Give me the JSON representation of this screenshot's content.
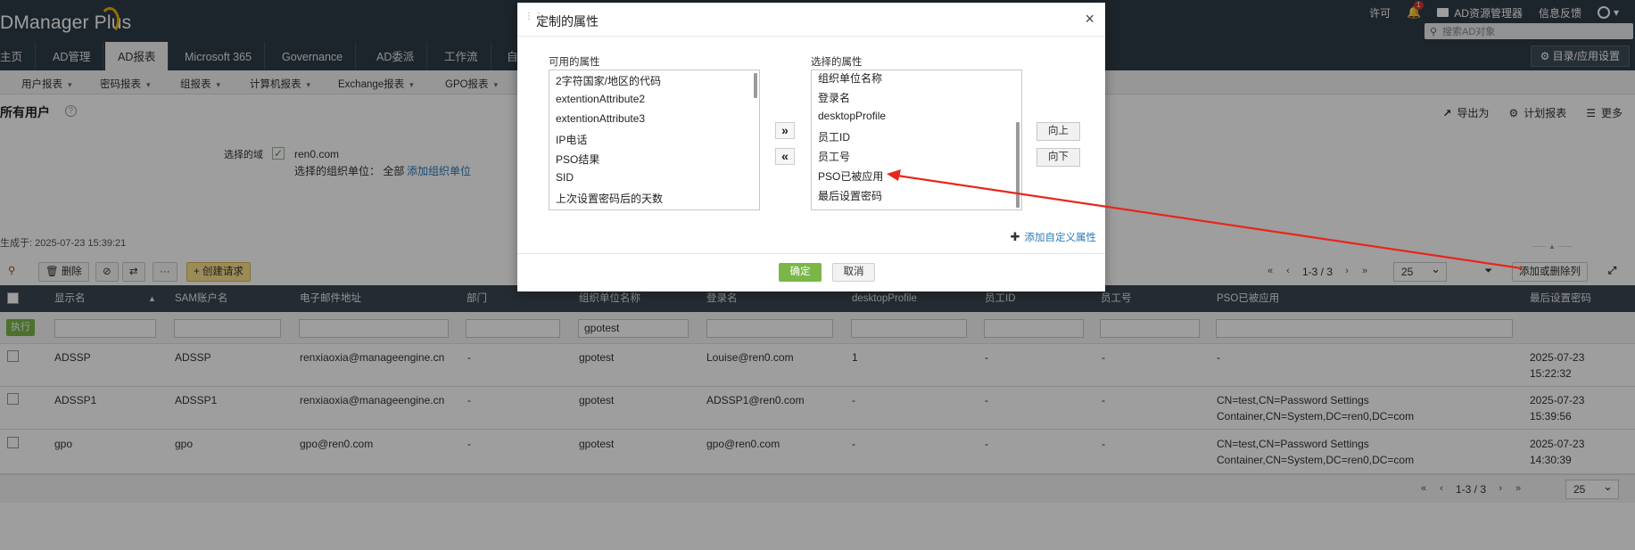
{
  "header": {
    "app_name": "DManager Plus",
    "links": {
      "license": "许可",
      "bell_count": "1",
      "ad_resource_manager": "AD资源管理器",
      "feedback": "信息反馈"
    },
    "search_placeholder": "搜索AD对象"
  },
  "nav": {
    "tabs": [
      "主页",
      "AD管理",
      "AD报表",
      "Microsoft 365",
      "Governance",
      "AD委派",
      "工作流",
      "自"
    ],
    "active_tab": "AD报表",
    "settings_button": "目录/应用设置"
  },
  "subnav": {
    "items": [
      "用户报表",
      "密码报表",
      "组报表",
      "计算机报表",
      "Exchange报表",
      "GPO报表"
    ]
  },
  "page": {
    "title": "所有用户",
    "help_icon": "?",
    "actions": [
      "导出为",
      "计划报表",
      "更多"
    ],
    "domain_label": "选择的域",
    "domain_value": "ren0.com",
    "ou_label": "选择的组织单位： 全部",
    "ou_link": "添加组织单位",
    "generated": "生成于: 2025-07-23 15:39:21"
  },
  "toolbar": {
    "delete_label": "删除",
    "more_label": "···",
    "create_request_label": "创建请求",
    "pager_text": "1-3 / 3",
    "page_size": "25",
    "add_remove_columns": "添加或删除列"
  },
  "table": {
    "columns": [
      "显示名",
      "SAM账户名",
      "电子邮件地址",
      "部门",
      "组织单位名称",
      "登录名",
      "desktopProfile",
      "员工ID",
      "员工号",
      "PSO已被应用",
      "最后设置密码"
    ],
    "execute_label": "执行",
    "filters": {
      "ou": "gpotest"
    },
    "rows": [
      {
        "display": "ADSSP",
        "sam": "ADSSP",
        "email": "renxiaoxia@manageengine.cn",
        "dept": "-",
        "ou": "gpotest",
        "logon": "Louise@ren0.com",
        "desktop": "1",
        "empid": "-",
        "empno": "-",
        "pso_line1": "-",
        "pso_line2": "",
        "pwd_line1": "2025-07-23",
        "pwd_line2": "15:22:32"
      },
      {
        "display": "ADSSP1",
        "sam": "ADSSP1",
        "email": "renxiaoxia@manageengine.cn",
        "dept": "-",
        "ou": "gpotest",
        "logon": "ADSSP1@ren0.com",
        "desktop": "-",
        "empid": "-",
        "empno": "-",
        "pso_line1": "CN=test,CN=Password Settings",
        "pso_line2": "Container,CN=System,DC=ren0,DC=com",
        "pwd_line1": "2025-07-23",
        "pwd_line2": "15:39:56"
      },
      {
        "display": "gpo",
        "sam": "gpo",
        "email": "gpo@ren0.com",
        "dept": "-",
        "ou": "gpotest",
        "logon": "gpo@ren0.com",
        "desktop": "-",
        "empid": "-",
        "empno": "-",
        "pso_line1": "CN=test,CN=Password Settings",
        "pso_line2": "Container,CN=System,DC=ren0,DC=com",
        "pwd_line1": "2025-07-23",
        "pwd_line2": "14:30:39"
      }
    ],
    "bottom_pager_text": "1-3 / 3",
    "bottom_page_size": "25"
  },
  "modal": {
    "title": "定制的属性",
    "available_label": "可用的属性",
    "selected_label": "选择的属性",
    "available": [
      "2字符国家/地区的代码",
      "extentionAttribute2",
      "extentionAttribute3",
      "IP电话",
      "PSO结果",
      "SID",
      "上次设置密码后的天数"
    ],
    "selected": [
      "组织单位名称",
      "登录名",
      "desktopProfile",
      "员工ID",
      "员工号",
      "PSO已被应用",
      "最后设置密码"
    ],
    "add_all": "»",
    "remove_all": "«",
    "move_up": "向上",
    "move_down": "向下",
    "add_custom": "添加自定义属性",
    "ok": "确定",
    "cancel": "取消",
    "close": "×"
  },
  "colors": {
    "header_bg": "#2f3c48",
    "ok_green": "#7ab648",
    "link_blue": "#2a7ab8",
    "annotation_red": "#e8261d"
  }
}
